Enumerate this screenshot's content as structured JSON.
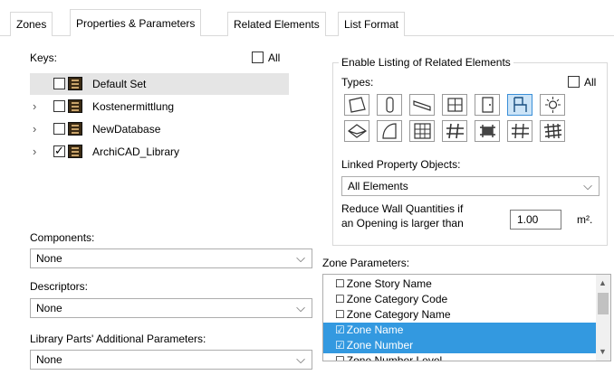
{
  "tabs": [
    {
      "label": "Zones"
    },
    {
      "label": "Properties & Parameters"
    },
    {
      "label": "Related Elements"
    },
    {
      "label": "List Format"
    }
  ],
  "keys": {
    "label": "Keys:",
    "all_label": "All",
    "items": [
      {
        "label": "Default Set",
        "checked": false
      },
      {
        "label": "Kostenermittlung",
        "checked": false
      },
      {
        "label": "NewDatabase",
        "checked": false
      },
      {
        "label": "ArchiCAD_Library",
        "checked": true
      }
    ]
  },
  "components": {
    "label": "Components:",
    "value": "None"
  },
  "descriptors": {
    "label": "Descriptors:",
    "value": "None"
  },
  "library_params": {
    "label": "Library Parts' Additional Parameters:",
    "value": "None"
  },
  "related": {
    "group_title": "Enable Listing of Related Elements",
    "types_label": "Types:",
    "all_label": "All",
    "type_icons": [
      "wall-icon",
      "column-icon",
      "beam-icon",
      "window-icon",
      "door-icon",
      "object-icon",
      "lamp-icon",
      "roof-icon",
      "shell-icon",
      "curtain-wall-icon",
      "railing-icon",
      "slab-icon",
      "mesh-icon",
      "morph-icon"
    ],
    "linked_label": "Linked Property Objects:",
    "linked_value": "All Elements",
    "reduce_label_1": "Reduce Wall Quantities if",
    "reduce_label_2": "an Opening is larger than",
    "reduce_value": "1.00",
    "reduce_unit": "m²."
  },
  "zone_params": {
    "label": "Zone Parameters:",
    "items": [
      {
        "label": "Zone Story Name",
        "checked": false
      },
      {
        "label": "Zone Category Code",
        "checked": false
      },
      {
        "label": "Zone Category Name",
        "checked": false
      },
      {
        "label": "Zone Name",
        "checked": true
      },
      {
        "label": "Zone Number",
        "checked": true
      },
      {
        "label": "Zone Number Level",
        "checked": false
      }
    ]
  }
}
